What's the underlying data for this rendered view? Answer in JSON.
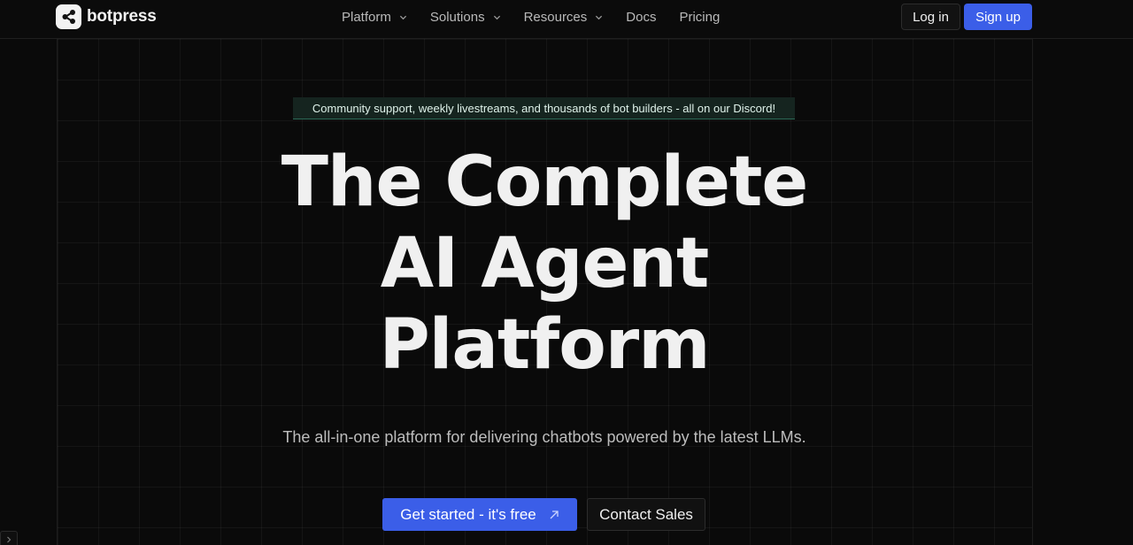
{
  "header": {
    "brand": "botpress",
    "nav": [
      {
        "label": "Platform",
        "has_dropdown": true
      },
      {
        "label": "Solutions",
        "has_dropdown": true
      },
      {
        "label": "Resources",
        "has_dropdown": true
      },
      {
        "label": "Docs",
        "has_dropdown": false
      },
      {
        "label": "Pricing",
        "has_dropdown": false
      }
    ],
    "login_label": "Log in",
    "signup_label": "Sign up"
  },
  "announcement": "Community support, weekly livestreams, and thousands of bot builders - all on our Discord!",
  "hero": {
    "title_lines": [
      "The Complete",
      "AI Agent",
      "Platform"
    ],
    "subtitle": "The all-in-one platform for delivering chatbots powered by the latest LLMs.",
    "cta_primary": "Get started - it's free",
    "cta_secondary": "Contact Sales"
  },
  "colors": {
    "background": "#0a0a0a",
    "accent": "#3b5ee8",
    "announcement_bg": "#15241f",
    "announcement_border": "#2d6b57"
  },
  "icons": {
    "logo": "share-nodes-icon",
    "dropdown": "chevron-down-icon",
    "cta_arrow": "arrow-up-right-icon",
    "side_tab": "chevron-right-icon"
  }
}
